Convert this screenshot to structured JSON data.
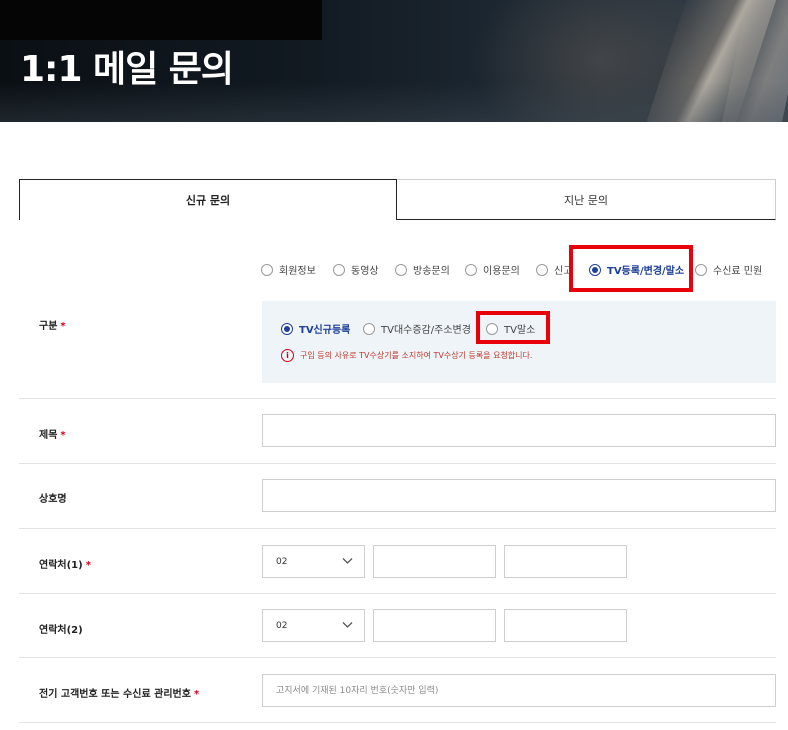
{
  "header": {
    "title": "1:1 메일 문의"
  },
  "tabs": [
    {
      "label": "신규 문의",
      "active": true
    },
    {
      "label": "지난 문의",
      "active": false
    }
  ],
  "category": {
    "label": "구분",
    "required_mark": "*",
    "options": [
      {
        "label": "회원정보",
        "checked": false
      },
      {
        "label": "동영상",
        "checked": false
      },
      {
        "label": "방송문의",
        "checked": false
      },
      {
        "label": "이용문의",
        "checked": false
      },
      {
        "label": "신고",
        "checked": false
      },
      {
        "label": "TV등록/변경/말소",
        "checked": true
      },
      {
        "label": "수신료 민원",
        "checked": false
      }
    ],
    "sub_options": [
      {
        "label": "TV신규등록",
        "checked": true
      },
      {
        "label": "TV대수증감/주소변경",
        "checked": false
      },
      {
        "label": "TV말소",
        "checked": false
      }
    ],
    "notice": "구입 등의 사유로 TV수상기를 소지하여 TV수상기 등록을 요청합니다."
  },
  "form": {
    "subject_label": "제목",
    "subject_required": "*",
    "company_label": "상호명",
    "phone1_label": "연락처(1)",
    "phone1_required": "*",
    "phone1_area": "02",
    "phone2_label": "연락처(2)",
    "phone2_area": "02",
    "account_label": "전기 고객번호 또는 수신료 관리번호",
    "account_required": "*",
    "account_placeholder": "고지서에 기재된 10자리 번호(숫자만 입력)"
  },
  "colors": {
    "accent": "#1e3f9a",
    "highlight": "#e8000b",
    "notice": "#c0392b",
    "sub_box_bg": "#eef4f8"
  }
}
